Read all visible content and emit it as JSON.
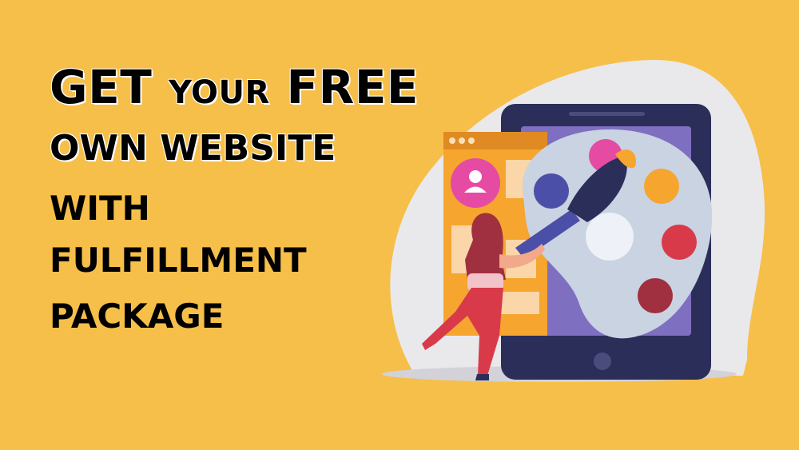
{
  "headline": {
    "line1_a": "GET",
    "line1_b": "YOUR",
    "line1_c": "FREE",
    "line2": "OWN WEBSITE",
    "line3": "WITH",
    "line4": "FULFILLMENT",
    "line5": "PACKAGE"
  },
  "illustration": {
    "icons": [
      "tablet-icon",
      "palette-icon",
      "paintbrush-icon",
      "user-profile-icon",
      "browser-window-icon",
      "woman-figure-icon"
    ]
  },
  "colors": {
    "background": "#F6BF4A",
    "blob": "#E9E9EC",
    "tablet": "#2C2E5A",
    "tablet_screen": "#7F6FC0",
    "window": "#F6A52F",
    "palette": "#C9D3E2",
    "pink": "#E64BA3",
    "red": "#D93A4A",
    "dark_red": "#A0303F"
  }
}
